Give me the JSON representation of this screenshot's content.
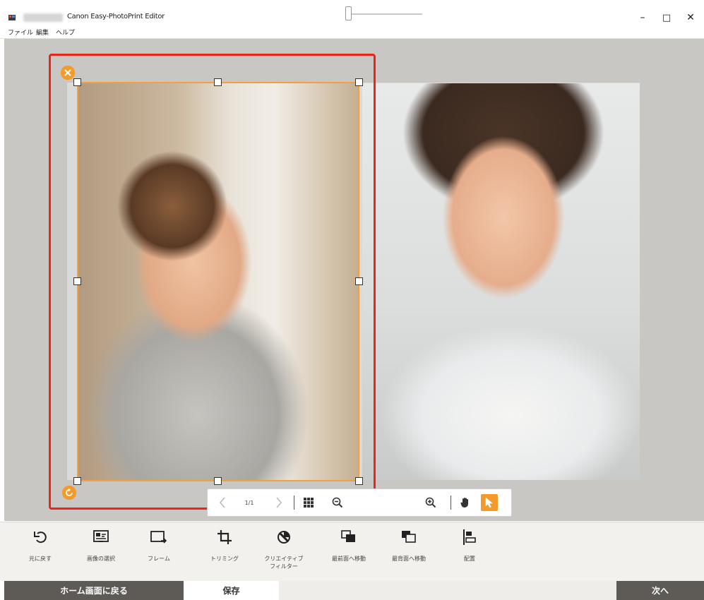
{
  "window": {
    "title": "Canon Easy-PhotoPrint Editor",
    "minimize_glyph": "–",
    "maximize_glyph": "□",
    "close_glyph": "✕"
  },
  "menu": {
    "items": [
      {
        "label": "ファイル"
      },
      {
        "label": "編集"
      },
      {
        "label": "ヘルプ"
      }
    ]
  },
  "canvas": {
    "selected_photo": "boy-eating-photo",
    "other_photo": "baby-smiling-photo",
    "delete_icon": "close-circle-icon",
    "rotate_icon": "rotate-icon",
    "accent_color": "#f39a2a",
    "selection_color": "#e8261e"
  },
  "floating_toolbar": {
    "page_indicator": "1/1",
    "prev_icon": "chevron-left-icon",
    "next_icon": "chevron-right-icon",
    "grid_icon": "grid-icon",
    "zoom_out_icon": "zoom-out-icon",
    "zoom_in_icon": "zoom-in-icon",
    "zoom_level": 0.0,
    "hand_icon": "hand-icon",
    "pointer_icon": "pointer-icon",
    "active_tool": "pointer"
  },
  "tools": [
    {
      "label": "元に戻す",
      "icon": "undo-icon"
    },
    {
      "label": "画像の選択",
      "icon": "select-image-icon"
    },
    {
      "label": "フレーム",
      "icon": "frame-icon"
    },
    {
      "label": "トリミング",
      "icon": "crop-icon"
    },
    {
      "label": "クリエイティブ\nフィルター",
      "icon": "creative-filter-icon"
    },
    {
      "label": "最前面へ移動",
      "icon": "bring-to-front-icon"
    },
    {
      "label": "最背面へ移動",
      "icon": "send-to-back-icon"
    },
    {
      "label": "配置",
      "icon": "align-icon"
    }
  ],
  "footer": {
    "home_label": "ホーム画面に戻る",
    "save_label": "保存",
    "next_label": "次へ"
  }
}
